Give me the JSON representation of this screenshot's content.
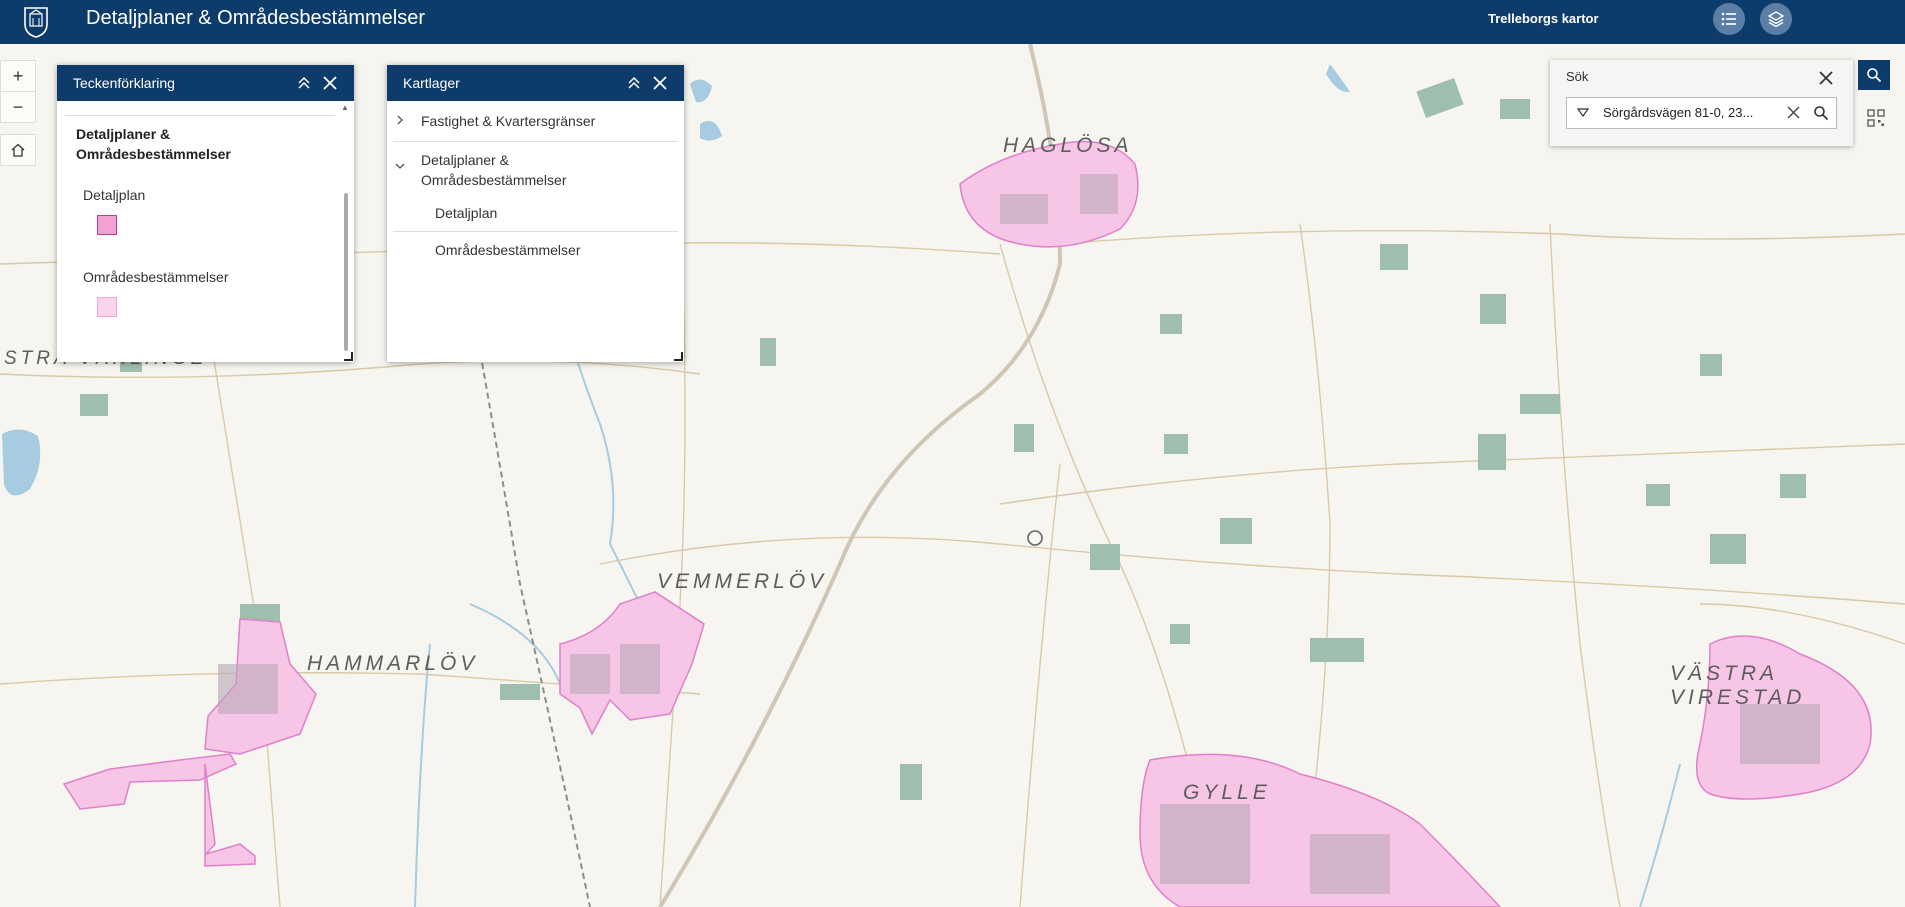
{
  "header": {
    "app_title": "Detaljplaner & Områdesbestämmelser",
    "org_title": "Trelleborgs kartor",
    "color": "#0e3c6a"
  },
  "icons": {
    "list": "list-icon",
    "layers": "layers-icon",
    "home": "home-icon",
    "search": "search-icon",
    "qr": "qr-icon"
  },
  "map_controls": {
    "zoom_in": "+",
    "zoom_out": "−"
  },
  "legend_panel": {
    "title": "Teckenförklaring",
    "group_title": "Detaljplaner & Områdesbestämmelser",
    "items": [
      {
        "label": "Detaljplan",
        "color": "#f2a2d2"
      },
      {
        "label": "Områdesbestämmelser",
        "color": "#fbd3ec"
      }
    ]
  },
  "layers_panel": {
    "title": "Kartlager",
    "items": [
      {
        "label": "Fastighet & Kvartersgränser"
      },
      {
        "label": "Detaljplaner & Områdesbestämmelser"
      },
      {
        "label": "Detaljplan"
      },
      {
        "label": "Områdesbestämmelser"
      }
    ]
  },
  "search": {
    "title": "Sök",
    "value": "Sörgårdsvägen 81-0, 23..."
  },
  "map_labels": [
    "HAGLÖSA",
    "STRA VÄRLINGE",
    "VEMMERLÖV",
    "HAMMARLÖV",
    "VÄSTRA VIRESTAD",
    "GYLLE"
  ],
  "colors": {
    "map_background": "#f6f5ef",
    "plan_fill": "#f7c6e6",
    "plan_stroke": "#e07fcb",
    "field": "#9fbfae",
    "road": "#d9c9a8",
    "water": "#a7cbe0"
  }
}
